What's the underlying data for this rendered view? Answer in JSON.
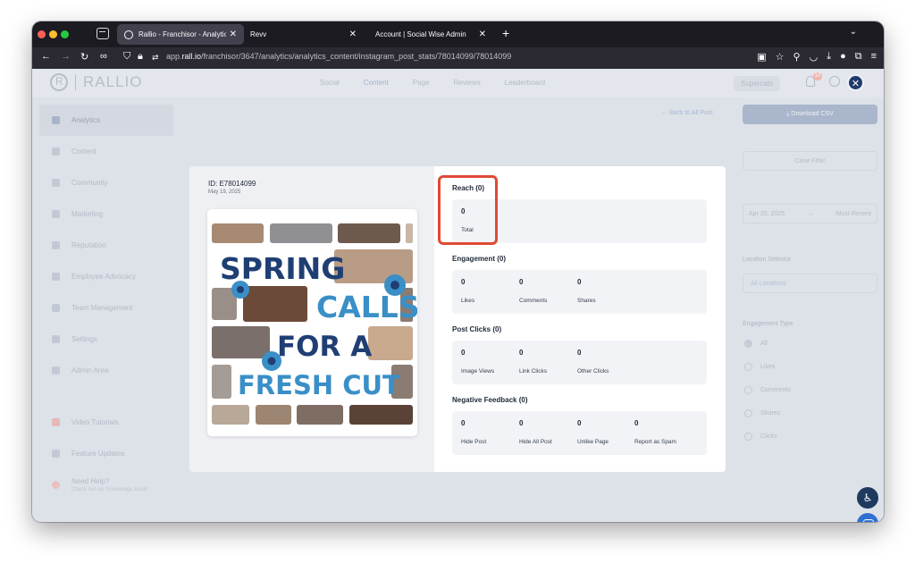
{
  "browser": {
    "tabs": [
      {
        "title": "Rallio - Franchisor - Analytics",
        "active": true
      },
      {
        "title": "Revv",
        "active": false
      },
      {
        "title": "Account | Social Wise Admin",
        "active": false
      }
    ],
    "new_tab": "+",
    "url_prefix": "app.",
    "url_domain": "rall.io",
    "url_path": "/franchisor/3647/analytics/analytics_content/instagram_post_stats/78014099/78014099"
  },
  "header": {
    "logo": "RALLIO",
    "nav": [
      "Social",
      "Content",
      "Page",
      "Reviews",
      "Leaderboard"
    ],
    "active_nav": "Content",
    "supercats": "Supercats",
    "notification_count": "10"
  },
  "sidebar": {
    "items": [
      {
        "label": "Analytics",
        "active": true
      },
      {
        "label": "Content"
      },
      {
        "label": "Community"
      },
      {
        "label": "Marketing"
      },
      {
        "label": "Reputation"
      },
      {
        "label": "Employee Advocacy"
      },
      {
        "label": "Team Management"
      },
      {
        "label": "Settings"
      },
      {
        "label": "Admin Area"
      }
    ],
    "bottom": [
      {
        "label": "Video Tutorials"
      },
      {
        "label": "Feature Updates"
      },
      {
        "label": "Need Help?",
        "sub": "Check out our Knowledge Base!"
      }
    ]
  },
  "right_panel": {
    "back_link": "Back to All Post",
    "download": "Download CSV",
    "clear_filter": "Clear Filter",
    "date_from": "Apr 20, 2025",
    "date_to": "Most Recent",
    "location_label": "Location Selector",
    "location_value": "All Locations",
    "engagement_label": "Engagement Type",
    "engagement_options": [
      "All",
      "Likes",
      "Comments",
      "Shares",
      "Clicks"
    ],
    "engagement_selected": "All"
  },
  "modal": {
    "post_id": "ID: E78014099",
    "post_date": "May 19, 2025",
    "image_text": [
      "SPRING",
      "CALLS",
      "FOR A",
      "FRESH CUT"
    ],
    "sections": [
      {
        "title": "Reach (0)",
        "stats": [
          {
            "value": "0",
            "label": "Total"
          }
        ]
      },
      {
        "title": "Engagement (0)",
        "stats": [
          {
            "value": "0",
            "label": "Likes"
          },
          {
            "value": "0",
            "label": "Comments"
          },
          {
            "value": "0",
            "label": "Shares"
          }
        ]
      },
      {
        "title": "Post Clicks (0)",
        "stats": [
          {
            "value": "0",
            "label": "Image Views"
          },
          {
            "value": "0",
            "label": "Link Clicks"
          },
          {
            "value": "0",
            "label": "Other Clicks"
          }
        ]
      },
      {
        "title": "Negative Feedback (0)",
        "stats": [
          {
            "value": "0",
            "label": "Hide Post"
          },
          {
            "value": "0",
            "label": "Hide All Post"
          },
          {
            "value": "0",
            "label": "Unlike Page"
          },
          {
            "value": "0",
            "label": "Report as Spam"
          }
        ]
      }
    ]
  },
  "colors": {
    "highlight": "#e04a35",
    "navy": "#1e3a5f",
    "poster_blue": "#1f3f74",
    "poster_teal": "#3a8fc7"
  }
}
